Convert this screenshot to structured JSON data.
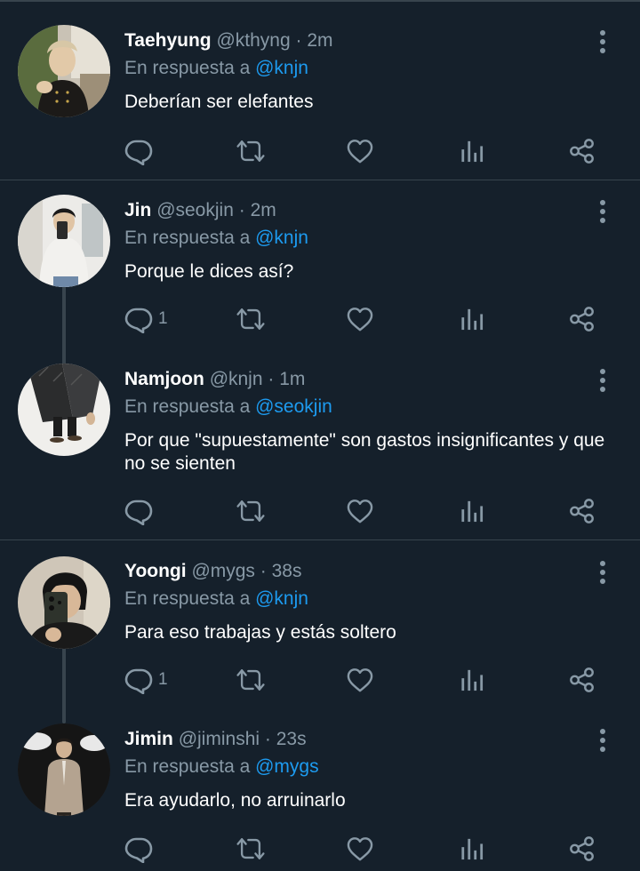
{
  "theme": {
    "background": "#15202b",
    "text": "#ffffff",
    "muted": "#8899a6",
    "mention": "#1d9bf0",
    "divider": "#38444d"
  },
  "tweets": [
    {
      "name": "Taehyung",
      "handle": "@kthyng",
      "dot": "·",
      "time": "2m",
      "reply_prefix": "En respuesta a",
      "reply_to": "@knjn",
      "text": "Deberían ser elefantes",
      "reply_count": "",
      "icons": [
        "reply-icon",
        "retweet-icon",
        "like-icon",
        "analytics-icon",
        "share-icon"
      ]
    },
    {
      "name": "Jin",
      "handle": "@seokjin",
      "dot": "·",
      "time": "2m",
      "reply_prefix": "En respuesta a",
      "reply_to": "@knjn",
      "text": "Porque le dices así?",
      "reply_count": "1"
    },
    {
      "name": "Namjoon",
      "handle": "@knjn",
      "dot": "·",
      "time": "1m",
      "reply_prefix": "En respuesta a",
      "reply_to": "@seokjin",
      "text": "Por que \"supuestamente\" son gastos insignificantes y que no se sienten",
      "reply_count": ""
    },
    {
      "name": "Yoongi",
      "handle": "@mygs",
      "dot": "·",
      "time": "38s",
      "reply_prefix": "En respuesta a",
      "reply_to": "@knjn",
      "text": "Para eso trabajas y estás soltero",
      "reply_count": "1"
    },
    {
      "name": "Jimin",
      "handle": "@jiminshi",
      "dot": "·",
      "time": "23s",
      "reply_prefix": "En respuesta a",
      "reply_to": "@mygs",
      "text": "Era ayudarlo, no arruinarlo",
      "reply_count": ""
    }
  ]
}
